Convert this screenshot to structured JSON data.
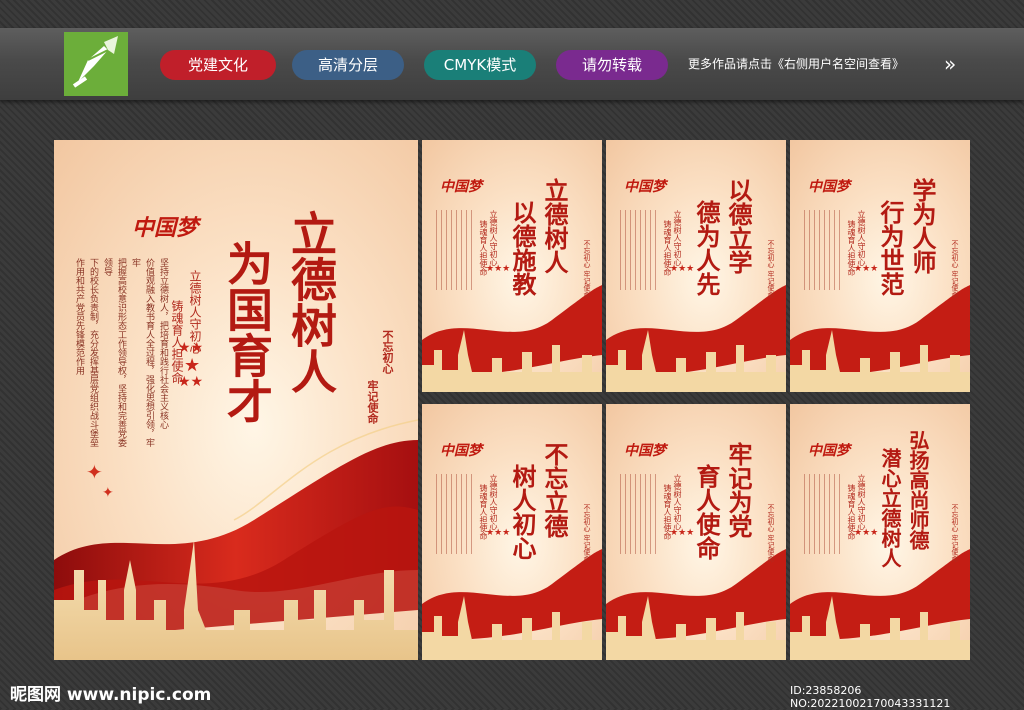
{
  "tags": [
    {
      "label": "党建文化",
      "color": "#c01f2a"
    },
    {
      "label": "高清分层",
      "color": "#3c5f86"
    },
    {
      "label": "CMYK模式",
      "color": "#1a7f78"
    },
    {
      "label": "请勿转载",
      "color": "#7a2a8f"
    }
  ],
  "notice": "更多作品请点击《右侧用户名空间查看》",
  "main_poster": {
    "brand": "中国梦",
    "title_col1": "立德树人",
    "title_col2": "为国育才",
    "subtitle_col1": "立德树人守初心",
    "subtitle_col2": "铸魂育人担使命",
    "body": [
      "坚持立德树人，把培育和践行社会主义核心",
      "价值观融入教书育人全过程，强化思想引领，牢牢",
      "把握高校意识形态工作领导权，坚持和完善党委领导",
      "下的校长负责制，充分发挥基层党组织战斗堡垒",
      "作用和共产党员先锋模范作用"
    ],
    "side_slogan_1": "不忘初心",
    "side_slogan_2": "牢记使命"
  },
  "small_posters": [
    {
      "title_col1": "立德树人",
      "title_col2": "以德施教"
    },
    {
      "title_col1": "以德立学",
      "title_col2": "德为人先"
    },
    {
      "title_col1": "学为人师",
      "title_col2": "行为世范"
    },
    {
      "title_col1": "不忘立德",
      "title_col2": "树人初心"
    },
    {
      "title_col1": "牢记为党",
      "title_col2": "育人使命"
    },
    {
      "title_col1": "弘扬高尚师德",
      "title_col2": "潜心立德树人"
    }
  ],
  "small_common": {
    "brand": "中国梦",
    "subtitle_col1": "立德树人守初心",
    "subtitle_col2": "铸魂育人担使命",
    "side_slogan": "不忘初心 牢记使命"
  },
  "watermark": "昵图网 www.nipic.com",
  "id_line": "ID:23858206 NO:20221002170043331121"
}
